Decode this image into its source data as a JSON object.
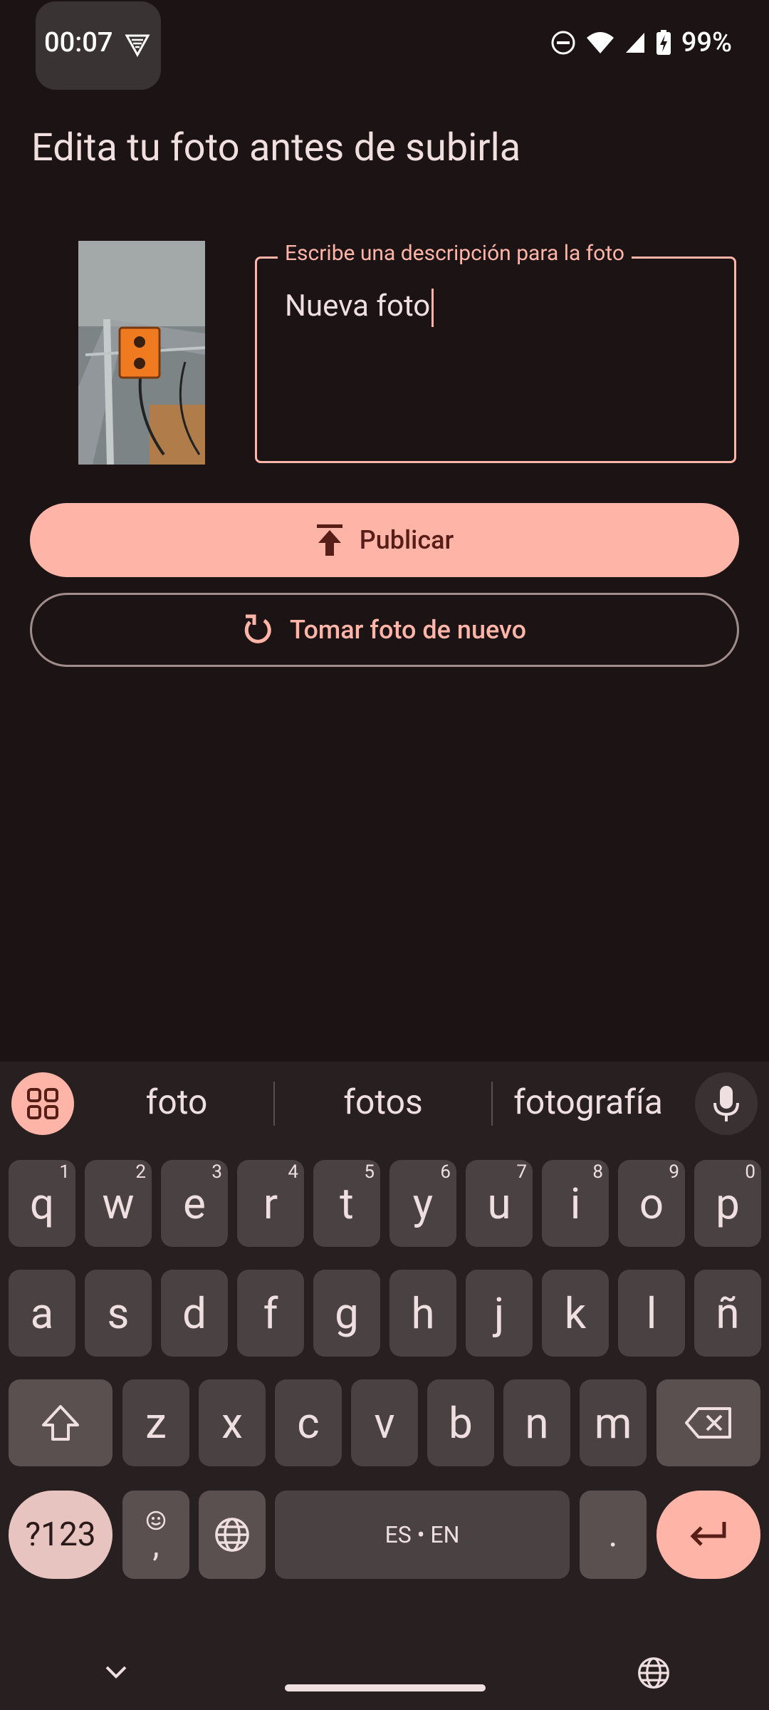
{
  "status": {
    "time": "00:07",
    "battery": "99%"
  },
  "screen": {
    "title": "Edita tu foto antes de subirla",
    "description_label": "Escribe una descripción para la foto",
    "description_value": "Nueva foto",
    "publish_label": "Publicar",
    "retake_label": "Tomar foto de nuevo"
  },
  "keyboard": {
    "suggestions": [
      "foto",
      "fotos",
      "fotografía"
    ],
    "row1": [
      {
        "k": "q",
        "n": "1"
      },
      {
        "k": "w",
        "n": "2"
      },
      {
        "k": "e",
        "n": "3"
      },
      {
        "k": "r",
        "n": "4"
      },
      {
        "k": "t",
        "n": "5"
      },
      {
        "k": "y",
        "n": "6"
      },
      {
        "k": "u",
        "n": "7"
      },
      {
        "k": "i",
        "n": "8"
      },
      {
        "k": "o",
        "n": "9"
      },
      {
        "k": "p",
        "n": "0"
      }
    ],
    "row2": [
      "a",
      "s",
      "d",
      "f",
      "g",
      "h",
      "j",
      "k",
      "l",
      "ñ"
    ],
    "row3": [
      "z",
      "x",
      "c",
      "v",
      "b",
      "n",
      "m"
    ],
    "symbols_label": "?123",
    "comma_label": ",",
    "period_label": ".",
    "space_label": "ES • EN"
  },
  "colors": {
    "accent": "#ffb4a8",
    "background": "#1c1314",
    "key": "#4a4142"
  }
}
